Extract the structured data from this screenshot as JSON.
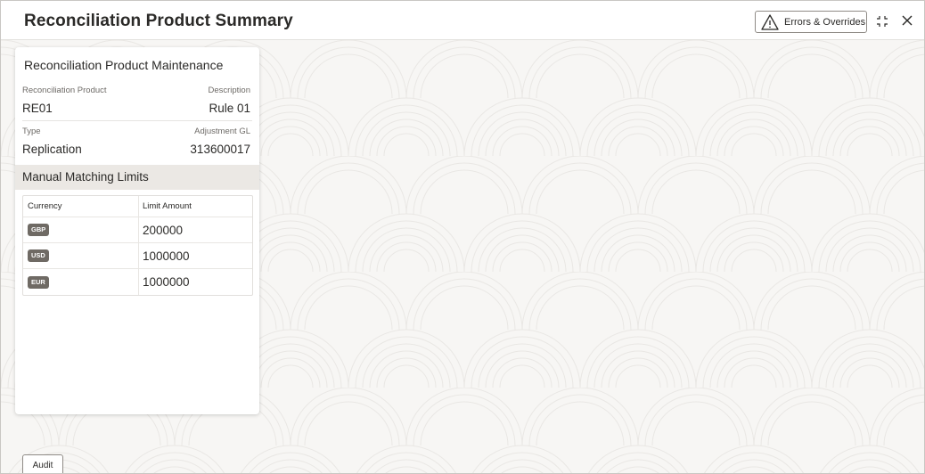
{
  "header": {
    "title": "Reconciliation Product Summary",
    "errors_button_label": "Errors & Overrides"
  },
  "card": {
    "title": "Reconciliation Product Maintenance",
    "fields": [
      {
        "label": "Reconciliation Product",
        "value": "RE01"
      },
      {
        "label": "Description",
        "value": "Rule 01"
      },
      {
        "label": "Type",
        "value": "Replication"
      },
      {
        "label": "Adjustment GL",
        "value": "313600017"
      }
    ],
    "section_title": "Manual Matching Limits",
    "table": {
      "headers": [
        "Currency",
        "Limit Amount"
      ],
      "rows": [
        {
          "currency": "GBP",
          "limit": "200000"
        },
        {
          "currency": "USD",
          "limit": "1000000"
        },
        {
          "currency": "EUR",
          "limit": "1000000"
        }
      ]
    }
  },
  "footer": {
    "audit_label": "Audit"
  },
  "icons": {
    "errors": "warning-triangle-icon",
    "minimize": "minimize-icon",
    "close": "close-icon"
  },
  "colors": {
    "badge": "#6f6a64",
    "section_header_bg": "#ebe8e4",
    "page_bg": "#f7f6f4"
  }
}
